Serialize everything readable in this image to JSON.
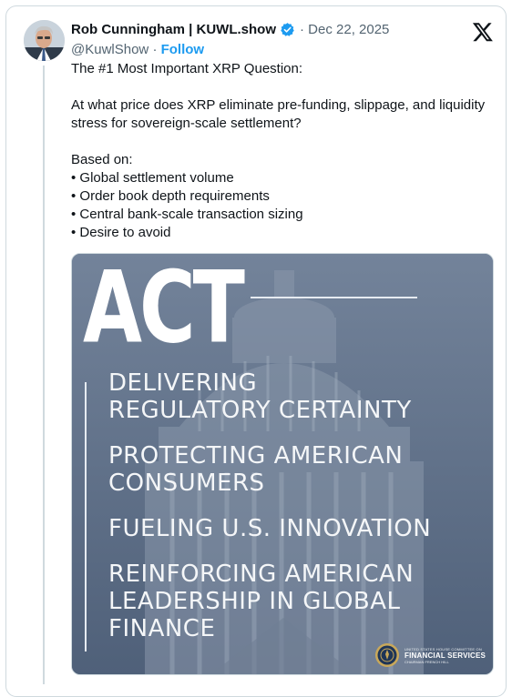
{
  "author": {
    "display_name": "Rob Cunningham | KUWL.show",
    "verified_icon": "verified-badge-icon",
    "handle": "@KuwlShow",
    "follow_label": "Follow",
    "date": "Dec 22, 2025",
    "separator": "·"
  },
  "platform_logo": "x-logo-icon",
  "tweet": {
    "text": "The #1 Most Important XRP Question:\n\nAt what price does XRP eliminate pre-funding, slippage, and liquidity stress for sovereign-scale settlement?\n\nBased on:\n• Global settlement volume\n• Order book depth requirements\n• Central bank-scale transaction sizing\n• Desire to avoid"
  },
  "media": {
    "big_word": "ACT",
    "lines": [
      "DELIVERING",
      "REGULATORY CERTAINTY",
      "PROTECTING AMERICAN",
      "CONSUMERS",
      "FUELING U.S. INNOVATION",
      "REINFORCING AMERICAN",
      "LEADERSHIP IN GLOBAL",
      "FINANCE"
    ],
    "seal_top": "UNITED STATES HOUSE COMMITTEE ON",
    "seal_main": "FINANCIAL SERVICES",
    "seal_sub": "CHAIRMAN FRENCH HILL"
  },
  "colors": {
    "accent": "#1d9bf0",
    "text": "#0f1419",
    "muted": "#536471",
    "media_bg": "#5b6d84"
  }
}
